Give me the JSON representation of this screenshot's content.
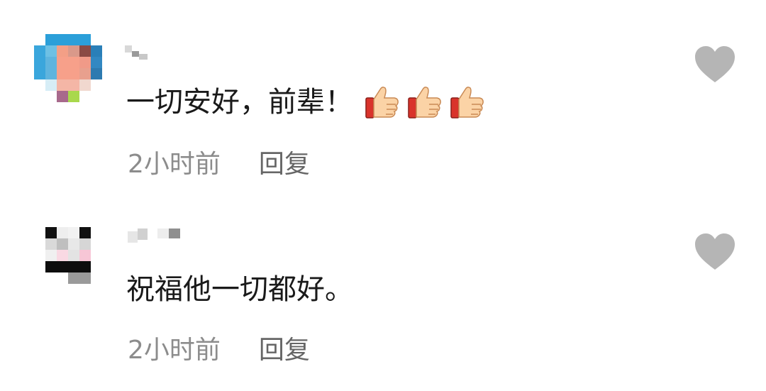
{
  "comments": [
    {
      "text": "一切安好，前辈！",
      "emoji_name": "thumbs-up-icon",
      "emoji_count": 3,
      "time": "2小时前",
      "reply_label": "回复"
    },
    {
      "text": "祝福他一切都好。",
      "time": "2小时前",
      "reply_label": "回复"
    }
  ],
  "colors": {
    "text": "#1a1a1a",
    "meta": "#8c8c8c",
    "like_icon": "#b5b5b5"
  }
}
